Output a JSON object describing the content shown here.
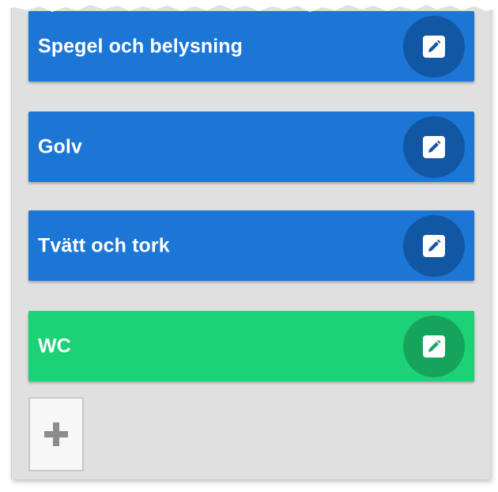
{
  "cards": [
    {
      "label": "Spegel och belysning",
      "color": "#1c76d6",
      "button_color": "#1257a3",
      "icon": "pencil-icon"
    },
    {
      "label": "Golv",
      "color": "#1c76d6",
      "button_color": "#1257a3",
      "icon": "pencil-icon"
    },
    {
      "label": "Tvätt och tork",
      "color": "#1c76d6",
      "button_color": "#1257a3",
      "icon": "pencil-icon"
    },
    {
      "label": "WC",
      "color": "#1bd276",
      "button_color": "#16a45b",
      "icon": "pencil-icon"
    }
  ],
  "add_button": {
    "icon": "plus-icon"
  },
  "colors": {
    "panel_background": "#e0e0e0",
    "card_blue": "#1c76d6",
    "card_green": "#1bd276"
  }
}
